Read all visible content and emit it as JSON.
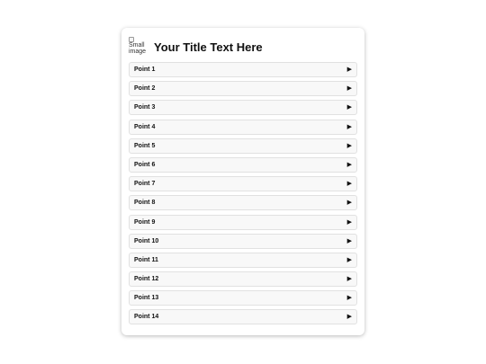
{
  "header": {
    "image_alt": "Small\nimage",
    "title": "Your Title Text Here"
  },
  "list": {
    "items": [
      {
        "label": "Point 1",
        "icon": "play-triangle-icon"
      },
      {
        "label": "Point 2",
        "icon": "play-triangle-icon"
      },
      {
        "label": "Point 3",
        "icon": "play-triangle-icon"
      },
      {
        "label": "Point 4",
        "icon": "play-triangle-icon"
      },
      {
        "label": "Point 5",
        "icon": "play-triangle-icon"
      },
      {
        "label": "Point 6",
        "icon": "play-triangle-icon"
      },
      {
        "label": "Point 7",
        "icon": "play-triangle-icon"
      },
      {
        "label": "Point 8",
        "icon": "play-triangle-icon"
      },
      {
        "label": "Point 9",
        "icon": "play-triangle-icon"
      },
      {
        "label": "Point 10",
        "icon": "play-triangle-icon"
      },
      {
        "label": "Point 11",
        "icon": "play-triangle-icon"
      },
      {
        "label": "Point 12",
        "icon": "play-triangle-icon"
      },
      {
        "label": "Point 13",
        "icon": "play-triangle-icon"
      },
      {
        "label": "Point 14",
        "icon": "play-triangle-icon"
      }
    ]
  },
  "colors": {
    "card_background": "#ffffff",
    "item_background": "#f8f8f8",
    "item_border": "#e1e1e1",
    "text": "#111111"
  }
}
